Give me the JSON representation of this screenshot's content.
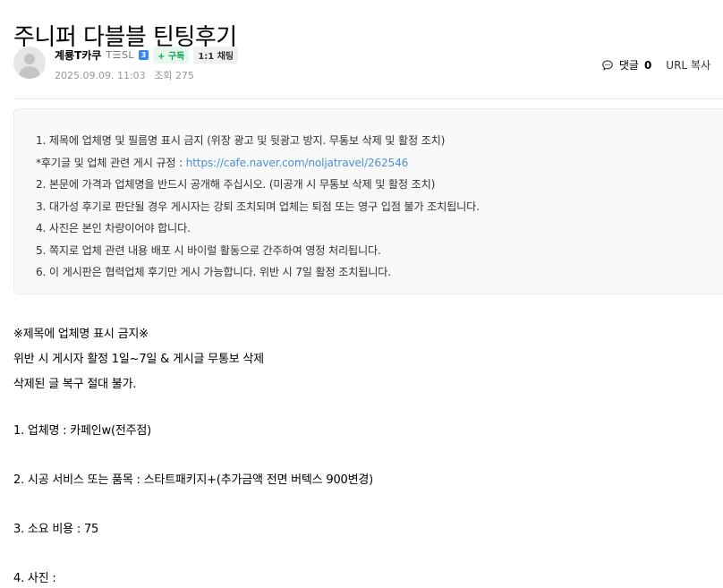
{
  "post": {
    "title": "주니퍼 다블블 틴팅후기"
  },
  "author": {
    "name": "계룡T카쿠",
    "level": "T☰SL",
    "level_badge": "3",
    "subscribe_label": "+ 구독",
    "chat_label": "1:1 채팅",
    "date": "2025.09.09. 11:03",
    "views": "조회 275"
  },
  "tools": {
    "comment_label": "댓글",
    "comment_count": "0",
    "url_copy_label": "URL 복사"
  },
  "notice": {
    "line1": "1. 제목에 업체명 및 필름명 표시 금지 (위장 광고 및 뒷광고 방지. 무통보 삭제 및 활정 조치)",
    "line2_prefix": "*후기글 및 업체 관련 게시 규정 : ",
    "line2_link": "https://cafe.naver.com/noljatravel/262546",
    "line3": "2. 본문에 가격과 업체명을 반드시 공개해 주십시오. (미공개 시 무통보 삭제 및 활정 조치)",
    "line4": "3. 대가성 후기로 판단될 경우 게시자는 강퇴 조치되며 업체는 퇴점 또는 영구 입점 불가 조치됩니다.",
    "line5": "4. 사진은 본인 차량이어야 합니다.",
    "line6": "5. 쪽지로 업체 관련 내용 배포 시 바이럴 활동으로 간주하여 영정 처리됩니다.",
    "line7": "6. 이 게시판은 협력업체 후기만 게시 가능합니다. 위반 시 7일 활정 조치됩니다."
  },
  "body": {
    "warning1": "※제목에 업체명 표시 금지※",
    "warning2": "위반 시 게시자 활정 1일~7일 & 게시글 무통보 삭제",
    "warning3": "삭제된 글 복구 절대 불가.",
    "item1": "1. 업체명 :  카페인w(전주점)",
    "item2": "2. 시공 서비스 또는 품목 :  스타트패키지+(추가금액 전면 버텍스 900변경)",
    "item3": "3. 소요 비용 :  75",
    "item4": "4. 사진 :"
  }
}
